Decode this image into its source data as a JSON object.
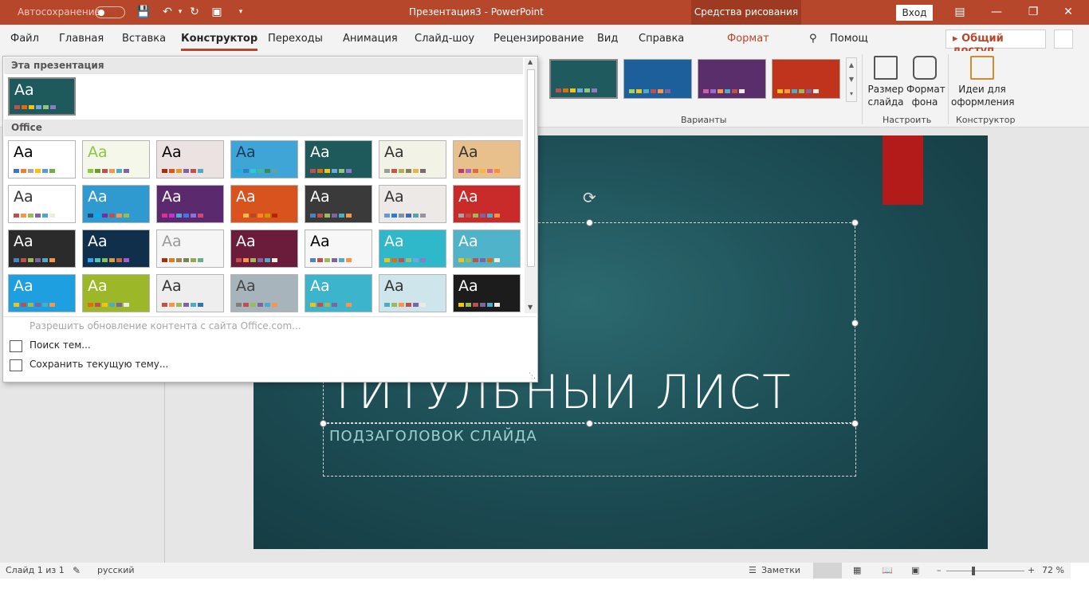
{
  "titlebar": {
    "autosave_label": "Автосохранение",
    "document_title": "Презентация3  -  PowerPoint",
    "context_tools": "Средства рисования",
    "signin_label": "Вход"
  },
  "ribbon_tabs": [
    "Файл",
    "Главная",
    "Вставка",
    "Конструктор",
    "Переходы",
    "Анимация",
    "Слайд-шоу",
    "Рецензирование",
    "Вид",
    "Справка",
    "Формат"
  ],
  "search_label": "Помощ",
  "share_label": "Общий доступ",
  "ribbon": {
    "variants_label": "Варианты",
    "customize_label": "Настроить",
    "designer_label": "Конструктор",
    "slide_size_label": "Размер слайда",
    "background_format_label": "Формат фона",
    "design_ideas_label": "Идеи для оформления",
    "variants": [
      {
        "bg": "#1f5a5e",
        "swatches": [
          "#c0504d",
          "#e36c0a",
          "#f2c314",
          "#6fa8dc",
          "#93c47d",
          "#8e7cc3"
        ]
      },
      {
        "bg": "#1d5f9a",
        "swatches": [
          "#a3d15c",
          "#f2c314",
          "#4bacc6",
          "#c0504d",
          "#f79646",
          "#8064a2"
        ]
      },
      {
        "bg": "#5a2d6b",
        "swatches": [
          "#d05ca6",
          "#9c6ad0",
          "#f79646",
          "#4bacc6",
          "#c0504d",
          "#eeece1"
        ]
      },
      {
        "bg": "#c0331c",
        "swatches": [
          "#f2c314",
          "#f79646",
          "#4bacc6",
          "#9bbb59",
          "#8064a2",
          "#eeece1"
        ]
      }
    ]
  },
  "gallery": {
    "this_presentation_header": "Эта презентация",
    "office_header": "Office",
    "current_theme": {
      "aa": "Aa",
      "bg": "#1e5a5c",
      "fg": "#ffffff",
      "swatches": [
        "#c0504d",
        "#e36c0a",
        "#f2c314",
        "#6fa8dc",
        "#93c47d",
        "#8e7cc3"
      ]
    },
    "themes": [
      {
        "aa": "Aa",
        "bg": "#ffffff",
        "fg": "#000000",
        "swatches": [
          "#4472c4",
          "#ed7d31",
          "#a5a5a5",
          "#ffc000",
          "#5b9bd5",
          "#70ad47"
        ]
      },
      {
        "aa": "Aa",
        "bg": "#f4f7ea",
        "fg": "#8dc63f",
        "swatches": [
          "#8dc63f",
          "#6b9a2e",
          "#c0504d",
          "#f79646",
          "#4bacc6",
          "#8064a2"
        ]
      },
      {
        "aa": "Aa",
        "bg": "#ece2e2",
        "fg": "#000000",
        "swatches": [
          "#a5300f",
          "#d55816",
          "#e19825",
          "#8064a2",
          "#c0504d",
          "#4bacc6"
        ]
      },
      {
        "aa": "Aa",
        "bg": "#3fa4d6",
        "fg": "#1a3a5c",
        "swatches": [
          "#1cade4",
          "#2683c6",
          "#27ced7",
          "#42ba97",
          "#3e8853",
          "#62a39f"
        ]
      },
      {
        "aa": "Aa",
        "bg": "#1e5a5c",
        "fg": "#ffffff",
        "swatches": [
          "#c0504d",
          "#e36c0a",
          "#f2c314",
          "#6fa8dc",
          "#93c47d",
          "#8e7cc3"
        ]
      },
      {
        "aa": "Aa",
        "bg": "#f2f2e6",
        "fg": "#333333",
        "swatches": [
          "#93a299",
          "#cf543f",
          "#b5ae53",
          "#848058",
          "#e8b54d",
          "#786c71"
        ]
      },
      {
        "aa": "Aa",
        "bg": "#e8c08c",
        "fg": "#333333",
        "swatches": [
          "#b83d68",
          "#ac66bb",
          "#de6c36",
          "#f9b639",
          "#cf6da4",
          "#fa8d3d"
        ]
      },
      {
        "aa": "Aa",
        "bg": "#ffffff",
        "fg": "#333333",
        "swatches": [
          "#c0504d",
          "#f79646",
          "#9bbb59",
          "#8064a2",
          "#4bacc6",
          "#eeece1"
        ]
      },
      {
        "aa": "Aa",
        "bg": "#2e9ad0",
        "fg": "#ffffff",
        "swatches": [
          "#1f497d",
          "#00b0f0",
          "#7030a0",
          "#c0504d",
          "#f79646",
          "#9bbb59"
        ]
      },
      {
        "aa": "Aa",
        "bg": "#5b2a6e",
        "fg": "#ffffff",
        "swatches": [
          "#e32d91",
          "#c830cc",
          "#4ea6dc",
          "#4775e7",
          "#8971e1",
          "#d54773"
        ]
      },
      {
        "aa": "Aa",
        "bg": "#d9531e",
        "fg": "#ffffff",
        "swatches": [
          "#e84c22",
          "#ffbd47",
          "#b64926",
          "#ff8427",
          "#cc9900",
          "#b22600"
        ]
      },
      {
        "aa": "Aa",
        "bg": "#3a3a3a",
        "fg": "#ffffff",
        "swatches": [
          "#4f81bd",
          "#c0504d",
          "#9bbb59",
          "#8064a2",
          "#4bacc6",
          "#f79646"
        ]
      },
      {
        "aa": "Aa",
        "bg": "#ece9e6",
        "fg": "#333333",
        "swatches": [
          "#629dd1",
          "#297fd5",
          "#7f8fa9",
          "#4a66ac",
          "#5aa2ae",
          "#9d90a0"
        ]
      },
      {
        "aa": "Aa",
        "bg": "#c92a2a",
        "fg": "#ffffff",
        "swatches": [
          "#a5a5a5",
          "#c0504d",
          "#9bbb59",
          "#8064a2",
          "#4bacc6",
          "#f79646"
        ]
      },
      {
        "aa": "Aa",
        "bg": "#2b2b2b",
        "fg": "#ffffff",
        "swatches": [
          "#4f81bd",
          "#c0504d",
          "#9bbb59",
          "#8064a2",
          "#4bacc6",
          "#f79646"
        ]
      },
      {
        "aa": "Aa",
        "bg": "#0f2f4a",
        "fg": "#ffffff",
        "swatches": [
          "#2fa3ee",
          "#4bcaad",
          "#86c157",
          "#d99c3f",
          "#ce6633",
          "#a35dd1"
        ]
      },
      {
        "aa": "Aa",
        "bg": "#f5f5f5",
        "fg": "#999999",
        "swatches": [
          "#a53010",
          "#de7e18",
          "#9f8351",
          "#728653",
          "#92aa4c",
          "#6aac91"
        ]
      },
      {
        "aa": "Aa",
        "bg": "#6a1c3a",
        "fg": "#ffffff",
        "swatches": [
          "#c0504d",
          "#f79646",
          "#9bbb59",
          "#8064a2",
          "#4bacc6",
          "#eeece1"
        ]
      },
      {
        "aa": "Aa",
        "bg": "#f7f7f7",
        "fg": "#000000",
        "swatches": [
          "#4f81bd",
          "#c0504d",
          "#9bbb59",
          "#8064a2",
          "#4bacc6",
          "#f79646"
        ]
      },
      {
        "aa": "Aa",
        "bg": "#2fb8c9",
        "fg": "#ffffff",
        "swatches": [
          "#f2c314",
          "#e36c0a",
          "#c0504d",
          "#93c47d",
          "#6fa8dc",
          "#8e7cc3"
        ]
      },
      {
        "aa": "Aa",
        "bg": "#4fb3c9",
        "fg": "#ffffff",
        "swatches": [
          "#f2c314",
          "#9bbb59",
          "#c0504d",
          "#8064a2",
          "#e36c0a",
          "#eeece1"
        ]
      },
      {
        "aa": "Aa",
        "bg": "#1ea0e0",
        "fg": "#ffffff",
        "swatches": [
          "#f2c314",
          "#c0504d",
          "#9bbb59",
          "#8064a2",
          "#4bacc6",
          "#f79646"
        ]
      },
      {
        "aa": "Aa",
        "bg": "#9cb829",
        "fg": "#ffffff",
        "swatches": [
          "#e36c0a",
          "#c0504d",
          "#f2c314",
          "#4bacc6",
          "#8064a2",
          "#eeece1"
        ]
      },
      {
        "aa": "Aa",
        "bg": "#eeeeee",
        "fg": "#333333",
        "swatches": [
          "#c0504d",
          "#f79646",
          "#9bbb59",
          "#8064a2",
          "#4bacc6",
          "#2e75b6"
        ]
      },
      {
        "aa": "Aa",
        "bg": "#a8b4bc",
        "fg": "#444444",
        "swatches": [
          "#7f7f7f",
          "#c0504d",
          "#9bbb59",
          "#8064a2",
          "#4bacc6",
          "#f79646"
        ]
      },
      {
        "aa": "Aa",
        "bg": "#3cb4cc",
        "fg": "#ffffff",
        "swatches": [
          "#f2c314",
          "#c0504d",
          "#9bbb59",
          "#8064a2",
          "#4bacc6",
          "#f79646"
        ]
      },
      {
        "aa": "Aa",
        "bg": "#cfe5ec",
        "fg": "#333333",
        "swatches": [
          "#4bacc6",
          "#9bbb59",
          "#f79646",
          "#c0504d",
          "#8064a2",
          "#eeece1"
        ]
      },
      {
        "aa": "Aa",
        "bg": "#1c1c1c",
        "fg": "#ffffff",
        "swatches": [
          "#f2c314",
          "#9bbb59",
          "#c0504d",
          "#8064a2",
          "#4bacc6",
          "#eeece1"
        ]
      }
    ],
    "menu": {
      "enable_updates": "Разрешить обновление контента с сайта Office.com...",
      "browse_themes": "Поиск тем...",
      "save_theme": "Сохранить текущую тему..."
    }
  },
  "slide": {
    "title": "ТИТУЛЬНЫЙ ЛИСТ",
    "subtitle": "ПОДЗАГОЛОВОК СЛАЙДА"
  },
  "statusbar": {
    "slide_counter": "Слайд 1 из 1",
    "language": "русский",
    "notes_label": "Заметки",
    "zoom": "72 %",
    "zoom_level": 0.72
  }
}
